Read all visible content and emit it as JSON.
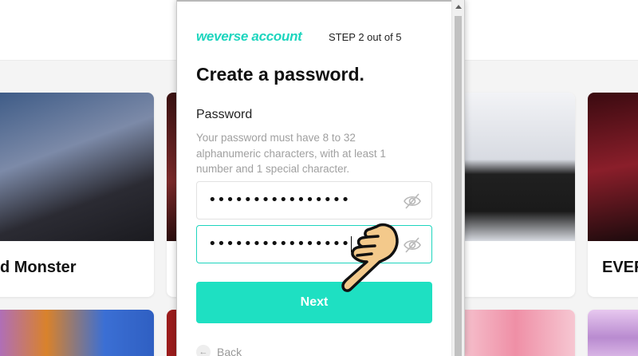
{
  "background": {
    "cards": [
      {
        "name": "d Monster",
        "photo_color": "#5a6f8f"
      },
      {
        "name": "",
        "photo_color": "#7a2a2a"
      },
      {
        "name": "",
        "photo_color": "#e3e6ec"
      },
      {
        "name": "EVER",
        "photo_color": "#6b1620"
      }
    ],
    "bottom_cards": [
      {
        "photo_color": "#d9822b"
      },
      {
        "photo_color": "#9b1c1c"
      },
      {
        "photo_color": "#f1a7b8"
      },
      {
        "photo_color": "#c9a0d6"
      }
    ]
  },
  "modal": {
    "logo": "weverse account",
    "step": "STEP 2 out of 5",
    "title": "Create a password.",
    "password_label": "Password",
    "hint": "Your password must have 8 to 32 alphanumeric characters, with at least 1 number and 1 special character.",
    "password_value": "••••••••••••••••",
    "confirm_value": "••••••••••••••••",
    "next_label": "Next",
    "back_label": "Back"
  },
  "colors": {
    "accent": "#1ed5be",
    "button": "#1ee0c2"
  },
  "icons": {
    "eye": "eye-off-icon",
    "cursor": "pointing-hand-icon",
    "back": "arrow-left-icon"
  }
}
